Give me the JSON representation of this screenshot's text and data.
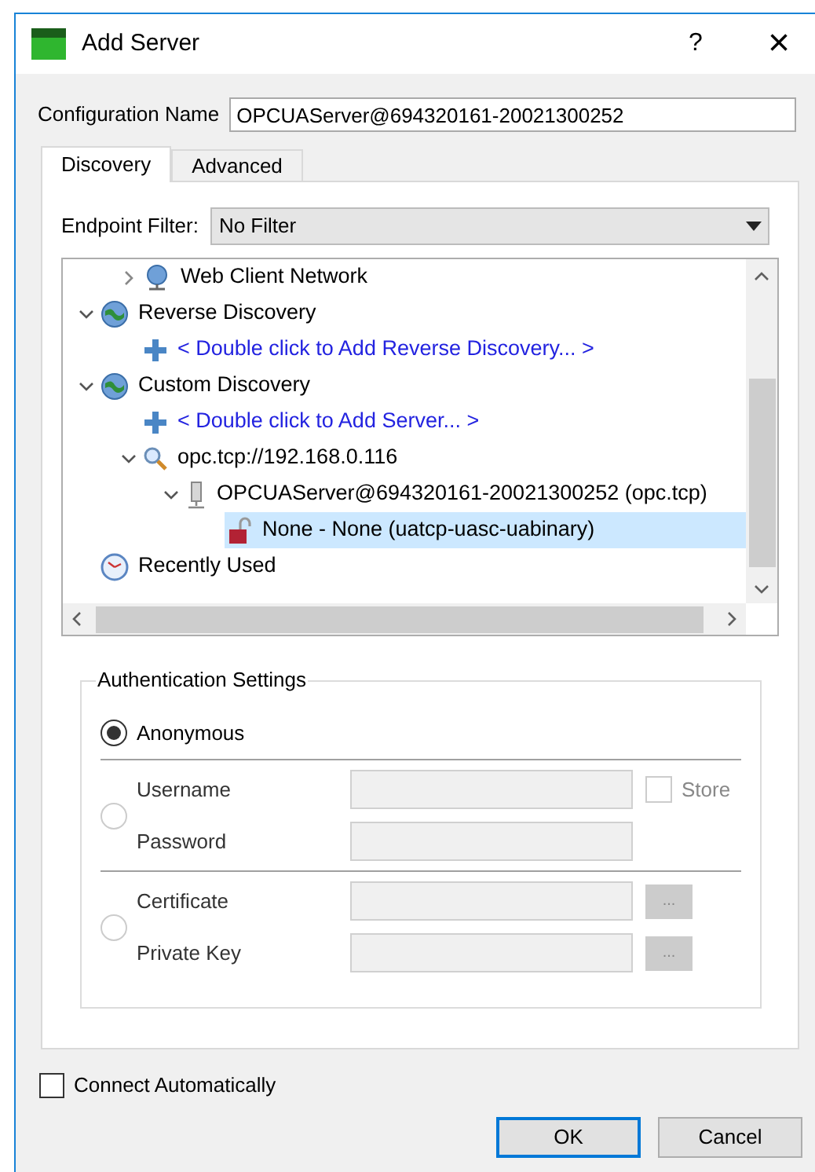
{
  "window": {
    "title": "Add Server",
    "help": "?",
    "close": "×"
  },
  "configuration_name": {
    "label": "Configuration Name",
    "value": "OPCUAServer@694320161-20021300252"
  },
  "tabs": [
    {
      "label": "Discovery",
      "selected": true
    },
    {
      "label": "Advanced",
      "selected": false
    }
  ],
  "endpoint_filter": {
    "label": "Endpoint Filter:",
    "value": "No Filter"
  },
  "tree": [
    {
      "children": [
        {
          "label": "Web Client Network",
          "kind": "network",
          "expanded": false
        }
      ]
    },
    {
      "label": "Reverse Discovery",
      "kind": "globe",
      "expanded": true,
      "children": [
        {
          "label": "< Double click to Add Reverse Discovery... >",
          "kind": "add"
        }
      ]
    },
    {
      "label": "Custom Discovery",
      "kind": "globe",
      "expanded": true,
      "children": [
        {
          "label": "< Double click to Add Server... >",
          "kind": "add"
        },
        {
          "label": "opc.tcp://192.168.0.116",
          "kind": "search",
          "expanded": true,
          "children": [
            {
              "label": "OPCUAServer@694320161-20021300252 (opc.tcp)",
              "kind": "server",
              "expanded": true,
              "children": [
                {
                  "label": "None - None (uatcp-uasc-uabinary)",
                  "kind": "lock",
                  "selected": true
                }
              ]
            }
          ]
        }
      ]
    },
    {
      "label": "Recently Used",
      "kind": "clock"
    }
  ],
  "authentication": {
    "title": "Authentication Settings",
    "options": [
      {
        "kind": "anonymous",
        "selected": true,
        "label": "Anonymous"
      },
      {
        "kind": "user",
        "selected": false,
        "fields": [
          {
            "label": "Username"
          },
          {
            "label": "Password"
          }
        ],
        "store": {
          "label": "Store",
          "checked": false
        }
      },
      {
        "kind": "certificate",
        "selected": false,
        "fields": [
          {
            "label": "Certificate",
            "browse": "..."
          },
          {
            "label": "Private Key",
            "browse": "..."
          }
        ]
      }
    ]
  },
  "connect_automatically": {
    "label": "Connect Automatically",
    "checked": false
  },
  "buttons": [
    {
      "label": "OK",
      "default": true
    },
    {
      "label": "Cancel",
      "default": false
    }
  ]
}
